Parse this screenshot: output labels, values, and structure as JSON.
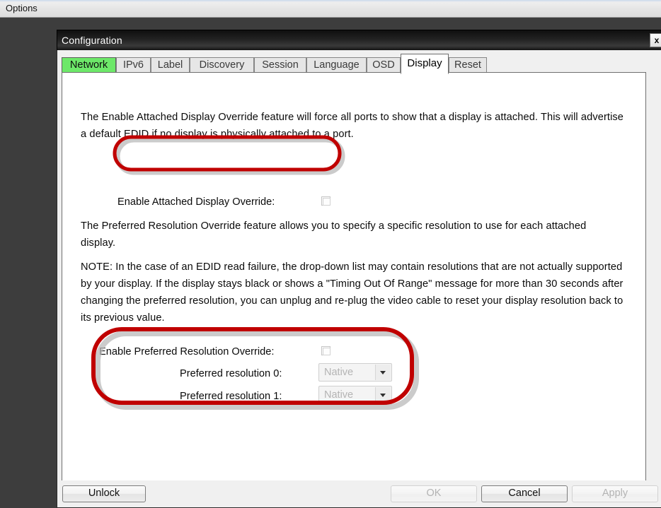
{
  "app_menubar": {
    "items": [
      {
        "label": "Options"
      }
    ]
  },
  "dialog": {
    "title": "Configuration",
    "close_label": "x",
    "tabs": [
      {
        "label": "Network",
        "state": "highlighted"
      },
      {
        "label": "IPv6",
        "state": "normal"
      },
      {
        "label": "Label",
        "state": "normal"
      },
      {
        "label": "Discovery",
        "state": "normal"
      },
      {
        "label": "Session",
        "state": "normal"
      },
      {
        "label": "Language",
        "state": "normal"
      },
      {
        "label": "OSD",
        "state": "normal"
      },
      {
        "label": "Display",
        "state": "active"
      },
      {
        "label": "Reset",
        "state": "normal"
      }
    ],
    "display_tab": {
      "paragraph_1": "The Enable Attached Display Override feature will force all ports to show that a display is attached. This will advertise a default EDID if no display is physically attached to a port.",
      "attached_override": {
        "label": "Enable Attached Display Override:",
        "checked": false
      },
      "paragraph_2": "The Preferred Resolution Override feature allows you to specify a specific resolution to use for each attached display.",
      "paragraph_3": "NOTE: In the case of an EDID read failure, the drop-down list may contain resolutions that are not actually supported by your display. If the display stays black or shows a \"Timing Out Of Range\" message for more than 30 seconds after changing the preferred resolution, you can unplug and re-plug the video cable to reset your display resolution back to its previous value.",
      "preferred_override": {
        "label": "Enable Preferred Resolution Override:",
        "checked": false
      },
      "resolution_0": {
        "label": "Preferred resolution 0:",
        "value": "Native",
        "enabled": false
      },
      "resolution_1": {
        "label": "Preferred resolution 1:",
        "value": "Native",
        "enabled": false
      }
    },
    "buttons": {
      "unlock": {
        "label": "Unlock",
        "enabled": true
      },
      "ok": {
        "label": "OK",
        "enabled": false
      },
      "cancel": {
        "label": "Cancel",
        "enabled": true
      },
      "apply": {
        "label": "Apply",
        "enabled": false
      }
    }
  },
  "annotations": {
    "highlight_color": "#c00000",
    "shadow_color": "#b8b8b8",
    "ellipse_1_target": "Enable Attached Display Override row",
    "ellipse_2_target": "Preferred resolution override group"
  },
  "colors": {
    "desktop_background": "#3d3d3d",
    "titlebar": "#1c1c1c",
    "tab_highlight_green": "#6de869",
    "panel_background": "#ffffff",
    "dialog_chrome": "#f0f0f0",
    "disabled_text": "#b3b3b3"
  }
}
